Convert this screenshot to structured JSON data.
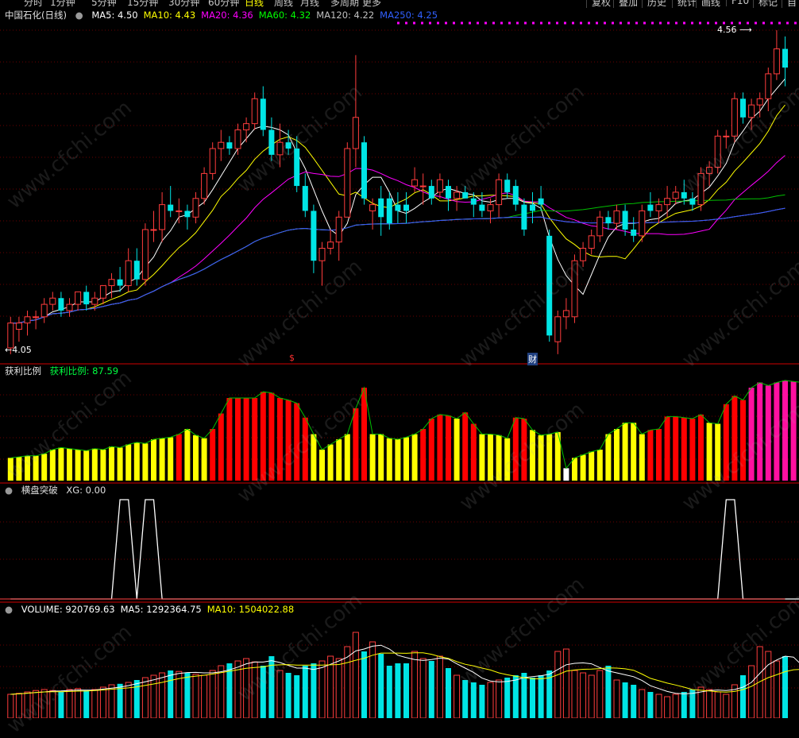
{
  "timeframe_tabs": [
    "分时",
    "1分钟",
    "5分钟",
    "15分钟",
    "30分钟",
    "60分钟",
    "日线",
    "周线",
    "月线",
    "多周期",
    "更多"
  ],
  "active_timeframe": "日线",
  "toolbar_buttons": [
    "复权",
    "叠加",
    "历史",
    "统计",
    "画线",
    "F10",
    "标记",
    "自"
  ],
  "watermark": "www.cfchi.com",
  "main_panel": {
    "title": "中国石化(日线)",
    "ma_labels": [
      {
        "text": "MA5: 4.50",
        "color": "#ffffff"
      },
      {
        "text": "MA10: 4.43",
        "color": "#ffff00"
      },
      {
        "text": "MA20: 4.36",
        "color": "#ff00ff"
      },
      {
        "text": "MA60: 4.32",
        "color": "#00ff00"
      },
      {
        "text": "MA120: 4.22",
        "color": "#c0c0c0"
      },
      {
        "text": "MA250: 4.25",
        "color": "#3060ff"
      }
    ],
    "high_label": "4.56",
    "low_label": "4.05",
    "marker_s": "$",
    "marker_cai": "财"
  },
  "profit_panel": {
    "title": "获利比例",
    "value_text": "获利比例: 87.59"
  },
  "xg_panel": {
    "title": "横盘突破",
    "value_text": "XG: 0.00"
  },
  "volume_panel": {
    "labels": [
      {
        "text": "VOLUME: 920769.63",
        "color": "#ffffff"
      },
      {
        "text": "MA5: 1292364.75",
        "color": "#ffffff"
      },
      {
        "text": "MA10: 1504022.88",
        "color": "#ffff00"
      }
    ]
  },
  "chart_data": {
    "type": "candlestick",
    "y_range": [
      4.05,
      4.56
    ],
    "candles": [
      {
        "o": 4.05,
        "h": 4.1,
        "l": 4.04,
        "c": 4.09
      },
      {
        "o": 4.08,
        "h": 4.1,
        "l": 4.06,
        "c": 4.09
      },
      {
        "o": 4.09,
        "h": 4.11,
        "l": 4.07,
        "c": 4.1
      },
      {
        "o": 4.1,
        "h": 4.11,
        "l": 4.08,
        "c": 4.1
      },
      {
        "o": 4.1,
        "h": 4.13,
        "l": 4.09,
        "c": 4.12
      },
      {
        "o": 4.12,
        "h": 4.14,
        "l": 4.11,
        "c": 4.13
      },
      {
        "o": 4.13,
        "h": 4.14,
        "l": 4.1,
        "c": 4.11
      },
      {
        "o": 4.11,
        "h": 4.13,
        "l": 4.1,
        "c": 4.12
      },
      {
        "o": 4.12,
        "h": 4.14,
        "l": 4.11,
        "c": 4.14
      },
      {
        "o": 4.14,
        "h": 4.15,
        "l": 4.11,
        "c": 4.12
      },
      {
        "o": 4.12,
        "h": 4.14,
        "l": 4.11,
        "c": 4.13
      },
      {
        "o": 4.13,
        "h": 4.15,
        "l": 4.12,
        "c": 4.15
      },
      {
        "o": 4.15,
        "h": 4.17,
        "l": 4.13,
        "c": 4.16
      },
      {
        "o": 4.16,
        "h": 4.18,
        "l": 4.14,
        "c": 4.15
      },
      {
        "o": 4.15,
        "h": 4.21,
        "l": 4.14,
        "c": 4.19
      },
      {
        "o": 4.19,
        "h": 4.21,
        "l": 4.15,
        "c": 4.16
      },
      {
        "o": 4.16,
        "h": 4.25,
        "l": 4.15,
        "c": 4.24
      },
      {
        "o": 4.24,
        "h": 4.27,
        "l": 4.22,
        "c": 4.24
      },
      {
        "o": 4.24,
        "h": 4.3,
        "l": 4.22,
        "c": 4.28
      },
      {
        "o": 4.28,
        "h": 4.31,
        "l": 4.26,
        "c": 4.27
      },
      {
        "o": 4.27,
        "h": 4.29,
        "l": 4.25,
        "c": 4.27
      },
      {
        "o": 4.27,
        "h": 4.28,
        "l": 4.24,
        "c": 4.26
      },
      {
        "o": 4.26,
        "h": 4.3,
        "l": 4.25,
        "c": 4.29
      },
      {
        "o": 4.29,
        "h": 4.34,
        "l": 4.28,
        "c": 4.33
      },
      {
        "o": 4.33,
        "h": 4.38,
        "l": 4.32,
        "c": 4.37
      },
      {
        "o": 4.37,
        "h": 4.4,
        "l": 4.35,
        "c": 4.38
      },
      {
        "o": 4.38,
        "h": 4.39,
        "l": 4.36,
        "c": 4.37
      },
      {
        "o": 4.37,
        "h": 4.41,
        "l": 4.36,
        "c": 4.4
      },
      {
        "o": 4.4,
        "h": 4.42,
        "l": 4.38,
        "c": 4.41
      },
      {
        "o": 4.41,
        "h": 4.46,
        "l": 4.4,
        "c": 4.45
      },
      {
        "o": 4.45,
        "h": 4.47,
        "l": 4.39,
        "c": 4.4
      },
      {
        "o": 4.4,
        "h": 4.42,
        "l": 4.35,
        "c": 4.36
      },
      {
        "o": 4.36,
        "h": 4.41,
        "l": 4.34,
        "c": 4.38
      },
      {
        "o": 4.38,
        "h": 4.4,
        "l": 4.36,
        "c": 4.37
      },
      {
        "o": 4.37,
        "h": 4.39,
        "l": 4.3,
        "c": 4.31
      },
      {
        "o": 4.31,
        "h": 4.33,
        "l": 4.26,
        "c": 4.27
      },
      {
        "o": 4.27,
        "h": 4.28,
        "l": 4.17,
        "c": 4.19
      },
      {
        "o": 4.19,
        "h": 4.22,
        "l": 4.15,
        "c": 4.21
      },
      {
        "o": 4.21,
        "h": 4.24,
        "l": 4.2,
        "c": 4.22
      },
      {
        "o": 4.22,
        "h": 4.27,
        "l": 4.19,
        "c": 4.26
      },
      {
        "o": 4.26,
        "h": 4.38,
        "l": 4.26,
        "c": 4.37
      },
      {
        "o": 4.37,
        "h": 4.52,
        "l": 4.34,
        "c": 4.42
      },
      {
        "o": 4.38,
        "h": 4.39,
        "l": 4.28,
        "c": 4.29
      },
      {
        "o": 4.27,
        "h": 4.29,
        "l": 4.24,
        "c": 4.28
      },
      {
        "o": 4.29,
        "h": 4.31,
        "l": 4.23,
        "c": 4.26
      },
      {
        "o": 4.29,
        "h": 4.3,
        "l": 4.24,
        "c": 4.25
      },
      {
        "o": 4.28,
        "h": 4.3,
        "l": 4.25,
        "c": 4.27
      },
      {
        "o": 4.28,
        "h": 4.3,
        "l": 4.25,
        "c": 4.27
      },
      {
        "o": 4.31,
        "h": 4.34,
        "l": 4.3,
        "c": 4.32
      },
      {
        "o": 4.31,
        "h": 4.33,
        "l": 4.28,
        "c": 4.31
      },
      {
        "o": 4.31,
        "h": 4.32,
        "l": 4.28,
        "c": 4.29
      },
      {
        "o": 4.3,
        "h": 4.33,
        "l": 4.29,
        "c": 4.32
      },
      {
        "o": 4.31,
        "h": 4.32,
        "l": 4.27,
        "c": 4.29
      },
      {
        "o": 4.29,
        "h": 4.31,
        "l": 4.27,
        "c": 4.3
      },
      {
        "o": 4.3,
        "h": 4.31,
        "l": 4.29,
        "c": 4.29
      },
      {
        "o": 4.29,
        "h": 4.3,
        "l": 4.26,
        "c": 4.28
      },
      {
        "o": 4.28,
        "h": 4.3,
        "l": 4.26,
        "c": 4.27
      },
      {
        "o": 4.27,
        "h": 4.29,
        "l": 4.25,
        "c": 4.28
      },
      {
        "o": 4.28,
        "h": 4.33,
        "l": 4.26,
        "c": 4.32
      },
      {
        "o": 4.32,
        "h": 4.33,
        "l": 4.29,
        "c": 4.3
      },
      {
        "o": 4.31,
        "h": 4.32,
        "l": 4.27,
        "c": 4.28
      },
      {
        "o": 4.28,
        "h": 4.29,
        "l": 4.23,
        "c": 4.24
      },
      {
        "o": 4.28,
        "h": 4.3,
        "l": 4.25,
        "c": 4.27
      },
      {
        "o": 4.29,
        "h": 4.31,
        "l": 4.27,
        "c": 4.28
      },
      {
        "o": 4.23,
        "h": 4.24,
        "l": 4.06,
        "c": 4.07
      },
      {
        "o": 4.06,
        "h": 4.11,
        "l": 4.04,
        "c": 4.1
      },
      {
        "o": 4.1,
        "h": 4.13,
        "l": 4.08,
        "c": 4.11
      },
      {
        "o": 4.1,
        "h": 4.2,
        "l": 4.09,
        "c": 4.19
      },
      {
        "o": 4.19,
        "h": 4.22,
        "l": 4.18,
        "c": 4.21
      },
      {
        "o": 4.21,
        "h": 4.24,
        "l": 4.2,
        "c": 4.23
      },
      {
        "o": 4.23,
        "h": 4.27,
        "l": 4.22,
        "c": 4.26
      },
      {
        "o": 4.26,
        "h": 4.27,
        "l": 4.24,
        "c": 4.25
      },
      {
        "o": 4.25,
        "h": 4.28,
        "l": 4.24,
        "c": 4.27
      },
      {
        "o": 4.27,
        "h": 4.28,
        "l": 4.23,
        "c": 4.24
      },
      {
        "o": 4.24,
        "h": 4.26,
        "l": 4.22,
        "c": 4.23
      },
      {
        "o": 4.23,
        "h": 4.28,
        "l": 4.22,
        "c": 4.27
      },
      {
        "o": 4.28,
        "h": 4.3,
        "l": 4.26,
        "c": 4.27
      },
      {
        "o": 4.27,
        "h": 4.29,
        "l": 4.25,
        "c": 4.28
      },
      {
        "o": 4.28,
        "h": 4.31,
        "l": 4.26,
        "c": 4.29
      },
      {
        "o": 4.29,
        "h": 4.31,
        "l": 4.28,
        "c": 4.3
      },
      {
        "o": 4.3,
        "h": 4.32,
        "l": 4.28,
        "c": 4.29
      },
      {
        "o": 4.29,
        "h": 4.3,
        "l": 4.27,
        "c": 4.28
      },
      {
        "o": 4.28,
        "h": 4.34,
        "l": 4.27,
        "c": 4.33
      },
      {
        "o": 4.33,
        "h": 4.35,
        "l": 4.31,
        "c": 4.34
      },
      {
        "o": 4.34,
        "h": 4.4,
        "l": 4.33,
        "c": 4.39
      },
      {
        "o": 4.39,
        "h": 4.4,
        "l": 4.37,
        "c": 4.39
      },
      {
        "o": 4.39,
        "h": 4.46,
        "l": 4.38,
        "c": 4.45
      },
      {
        "o": 4.45,
        "h": 4.46,
        "l": 4.41,
        "c": 4.42
      },
      {
        "o": 4.42,
        "h": 4.45,
        "l": 4.4,
        "c": 4.44
      },
      {
        "o": 4.44,
        "h": 4.46,
        "l": 4.42,
        "c": 4.45
      },
      {
        "o": 4.45,
        "h": 4.5,
        "l": 4.43,
        "c": 4.49
      },
      {
        "o": 4.49,
        "h": 4.56,
        "l": 4.48,
        "c": 4.53
      },
      {
        "o": 4.53,
        "h": 4.55,
        "l": 4.47,
        "c": 4.5
      }
    ],
    "profit_ratio": [
      22,
      23,
      24,
      24,
      26,
      30,
      32,
      31,
      30,
      29,
      31,
      30,
      33,
      32,
      35,
      37,
      36,
      40,
      41,
      42,
      45,
      50,
      44,
      41,
      50,
      65,
      80,
      80,
      80,
      80,
      86,
      85,
      80,
      78,
      75,
      61,
      45,
      30,
      35,
      40,
      45,
      70,
      90,
      45,
      45,
      41,
      40,
      42,
      45,
      50,
      60,
      64,
      63,
      60,
      66,
      55,
      45,
      45,
      44,
      41,
      61,
      60,
      49,
      44,
      45,
      47,
      12,
      22,
      25,
      28,
      30,
      45,
      50,
      56,
      56,
      45,
      49,
      50,
      62,
      62,
      61,
      60,
      64,
      56,
      55,
      74,
      82,
      78,
      90,
      95,
      92,
      95,
      97,
      96,
      95
    ],
    "profit_colors": [
      "y",
      "y",
      "y",
      "y",
      "y",
      "y",
      "y",
      "y",
      "y",
      "y",
      "y",
      "y",
      "y",
      "y",
      "y",
      "y",
      "y",
      "y",
      "y",
      "y",
      "r",
      "y",
      "y",
      "y",
      "r",
      "r",
      "r",
      "r",
      "r",
      "r",
      "r",
      "r",
      "r",
      "r",
      "r",
      "r",
      "y",
      "y",
      "y",
      "y",
      "y",
      "r",
      "r",
      "y",
      "y",
      "y",
      "y",
      "y",
      "y",
      "r",
      "r",
      "r",
      "r",
      "y",
      "r",
      "r",
      "y",
      "y",
      "y",
      "y",
      "r",
      "r",
      "y",
      "y",
      "y",
      "y",
      "w",
      "y",
      "y",
      "y",
      "y",
      "y",
      "y",
      "y",
      "y",
      "y",
      "r",
      "r",
      "r",
      "r",
      "r",
      "r",
      "r",
      "y",
      "y",
      "r",
      "r",
      "r",
      "p",
      "p",
      "p",
      "p",
      "p",
      "p",
      "p"
    ],
    "xg_signal": [
      0,
      0,
      0,
      0,
      0,
      0,
      0,
      0,
      0,
      0,
      0,
      0,
      0,
      1,
      1,
      0,
      1,
      1,
      0,
      0,
      0,
      0,
      0,
      0,
      0,
      0,
      0,
      0,
      0,
      0,
      0,
      0,
      0,
      0,
      0,
      0,
      0,
      0,
      0,
      0,
      0,
      0,
      0,
      0,
      0,
      0,
      0,
      0,
      0,
      0,
      0,
      0,
      0,
      0,
      0,
      0,
      0,
      0,
      0,
      0,
      0,
      0,
      0,
      0,
      0,
      0,
      0,
      0,
      0,
      0,
      0,
      0,
      0,
      0,
      0,
      0,
      0,
      0,
      0,
      0,
      0,
      0,
      0,
      0,
      0,
      1,
      1,
      0,
      0,
      0,
      0,
      0,
      0,
      0,
      0
    ],
    "volume": [
      50,
      52,
      55,
      58,
      60,
      58,
      55,
      60,
      62,
      58,
      60,
      65,
      70,
      72,
      75,
      80,
      85,
      90,
      95,
      100,
      98,
      95,
      92,
      90,
      100,
      110,
      115,
      120,
      125,
      118,
      110,
      130,
      100,
      95,
      90,
      110,
      115,
      120,
      130,
      125,
      150,
      180,
      140,
      160,
      135,
      110,
      115,
      115,
      140,
      125,
      120,
      130,
      105,
      90,
      80,
      75,
      70,
      75,
      80,
      85,
      90,
      95,
      85,
      90,
      100,
      140,
      145,
      100,
      95,
      90,
      100,
      110,
      80,
      75,
      70,
      60,
      55,
      50,
      45,
      50,
      55,
      60,
      65,
      60,
      55,
      50,
      70,
      90,
      110,
      150,
      140,
      120,
      130,
      100,
      65
    ]
  }
}
